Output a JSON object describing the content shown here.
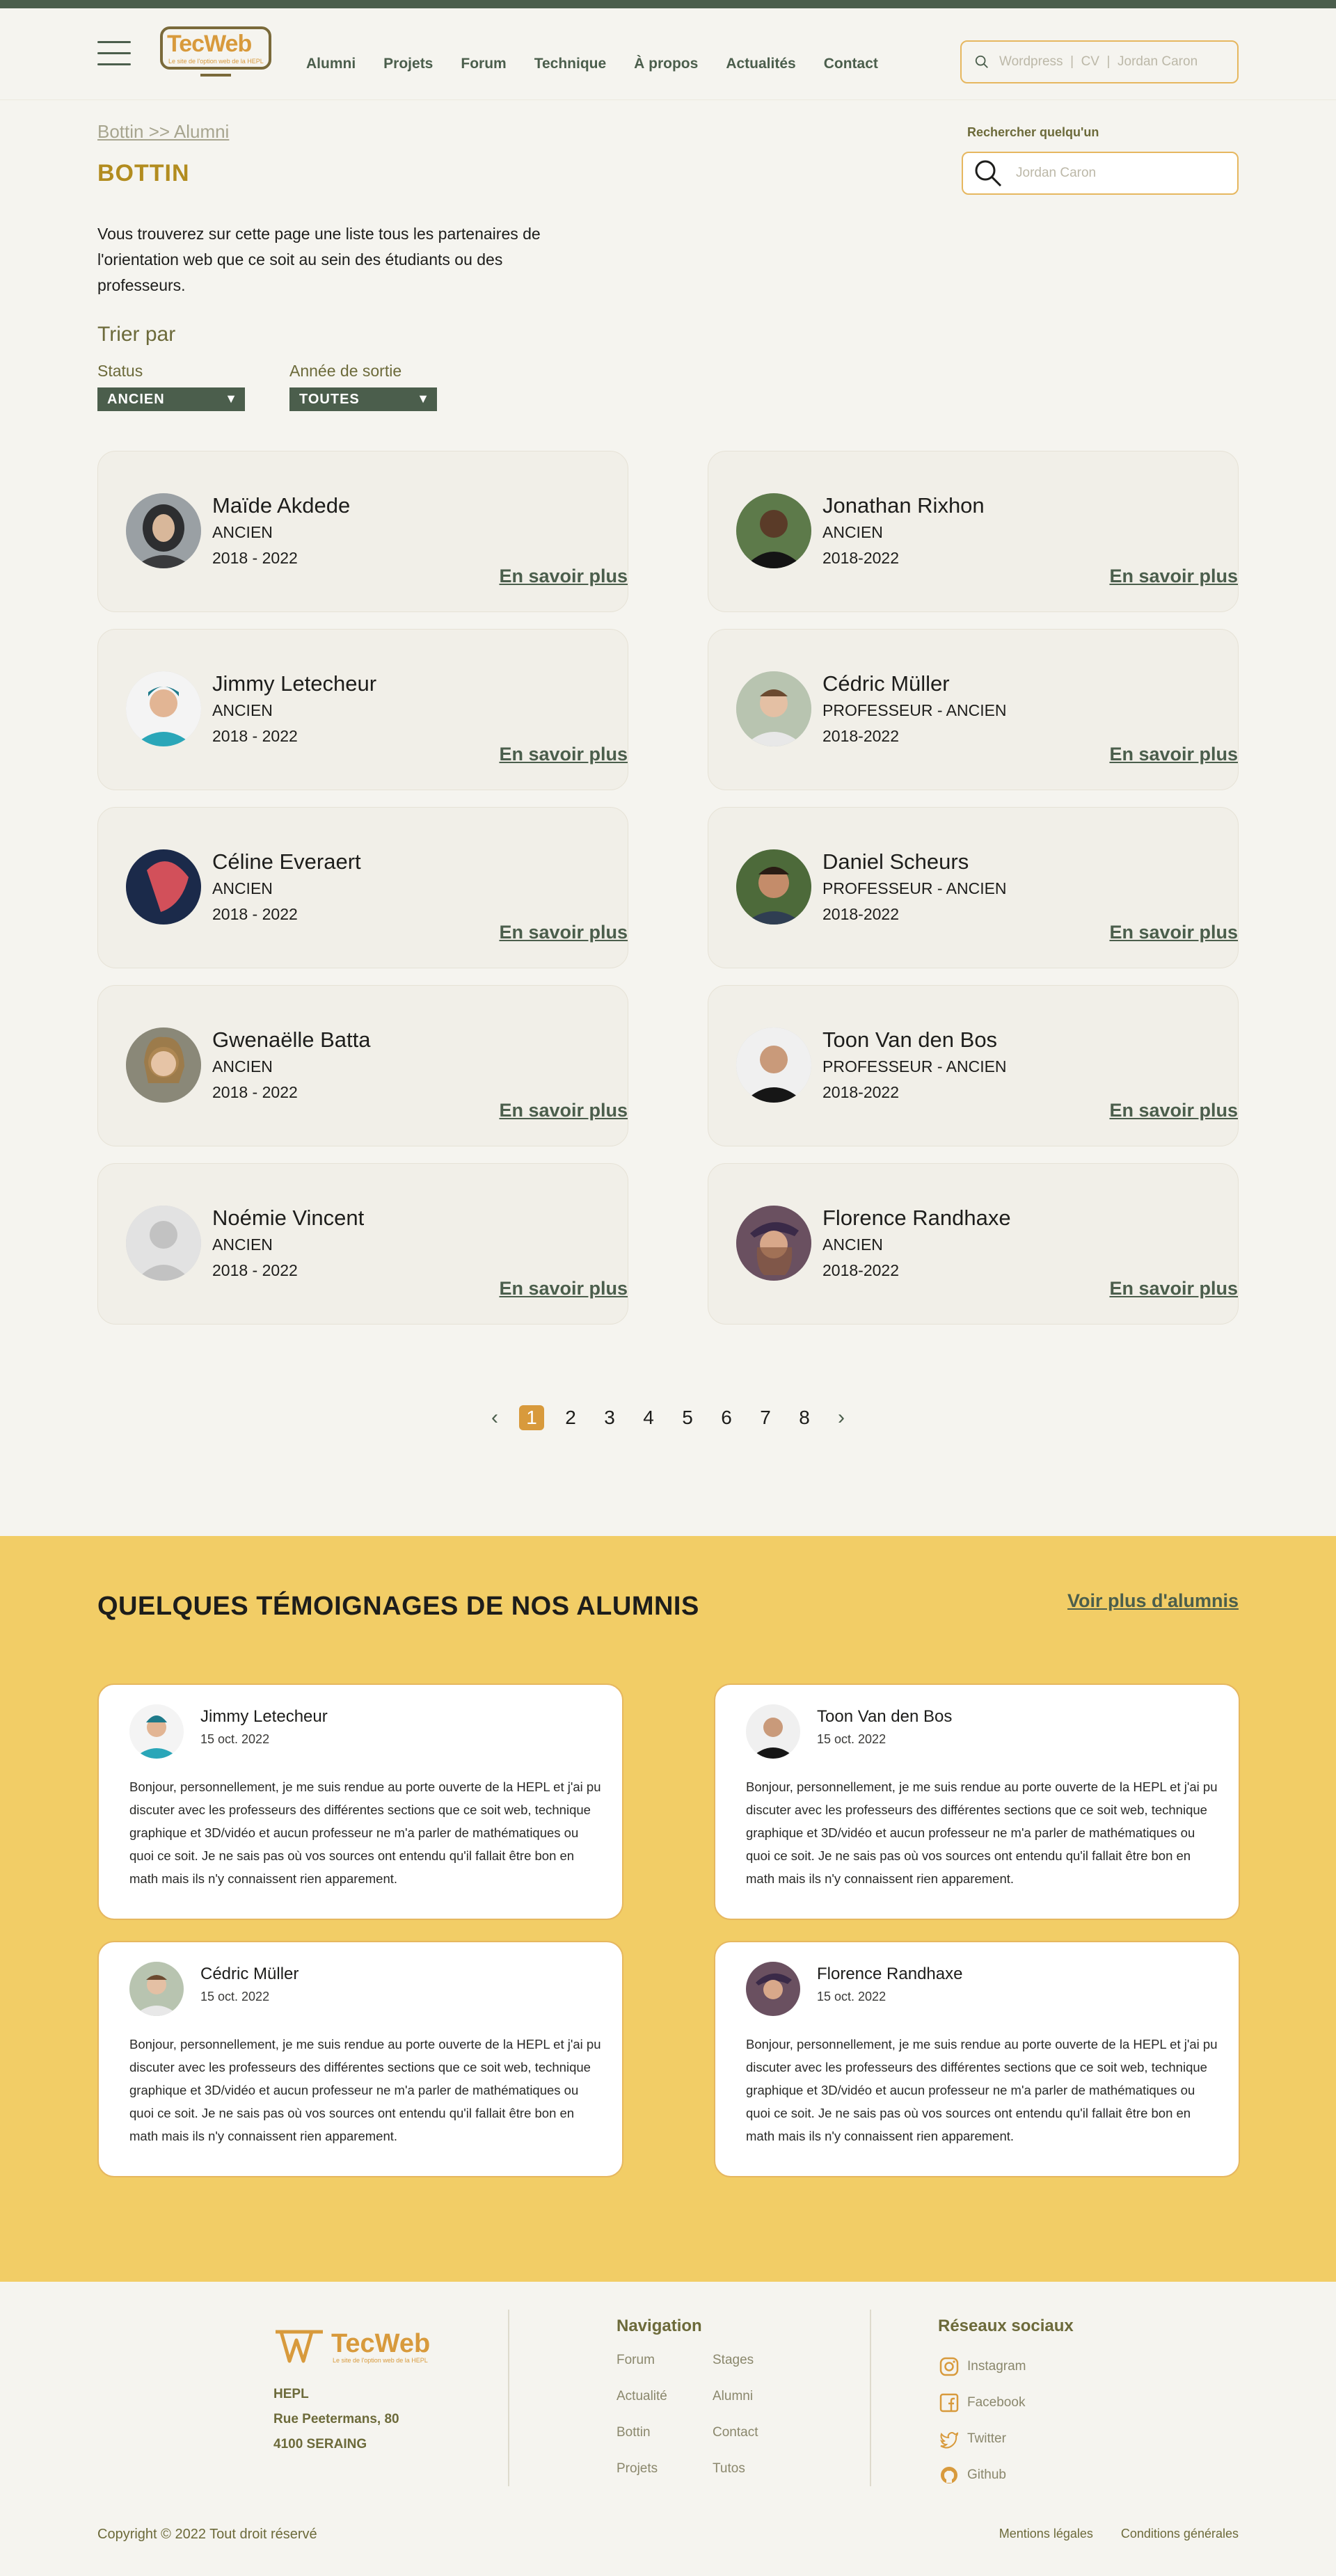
{
  "header": {
    "logo_text": "TecWeb",
    "logo_tagline": "Le site de l'option web de la HEPL",
    "nav": [
      "Alumni",
      "Projets",
      "Forum",
      "Technique",
      "À propos",
      "Actualités",
      "Contact"
    ],
    "search_placeholder": "Wordpress  |  CV  |  Jordan Caron"
  },
  "main": {
    "breadcrumb": "Bottin >> Alumni",
    "title": "BOTTIN",
    "intro": "Vous trouverez sur cette page une liste tous les partenaires de l'orientation web que ce soit au sein des étudiants ou des professeurs.",
    "sort_title": "Trier par",
    "filters": {
      "status_label": "Status",
      "status_value": "ANCIEN",
      "year_label": "Année de sortie",
      "year_value": "TOUTES"
    },
    "people_search_label": "Rechercher quelqu'un",
    "people_search_placeholder": "Jordan Caron",
    "more_label": "En savoir plus",
    "people": [
      {
        "name": "Maïde Akdede",
        "role": "ANCIEN",
        "years": "2018 - 2022"
      },
      {
        "name": "Jonathan Rixhon",
        "role": "ANCIEN",
        "years": "2018-2022"
      },
      {
        "name": "Jimmy Letecheur",
        "role": "ANCIEN",
        "years": "2018 - 2022"
      },
      {
        "name": "Cédric Müller",
        "role": "PROFESSEUR - ANCIEN",
        "years": "2018-2022"
      },
      {
        "name": "Céline Everaert",
        "role": "ANCIEN",
        "years": "2018 - 2022"
      },
      {
        "name": "Daniel Scheurs",
        "role": "PROFESSEUR - ANCIEN",
        "years": "2018-2022"
      },
      {
        "name": "Gwenaëlle Batta",
        "role": "ANCIEN",
        "years": "2018 - 2022"
      },
      {
        "name": "Toon Van den Bos",
        "role": "PROFESSEUR - ANCIEN",
        "years": "2018-2022"
      },
      {
        "name": "Noémie Vincent",
        "role": "ANCIEN",
        "years": "2018 - 2022"
      },
      {
        "name": "Florence Randhaxe",
        "role": "ANCIEN",
        "years": "2018-2022"
      }
    ],
    "pagination": {
      "pages": [
        "1",
        "2",
        "3",
        "4",
        "5",
        "6",
        "7",
        "8"
      ],
      "current": "1",
      "prev": "‹",
      "next": "›"
    }
  },
  "testimonials": {
    "title": "QUELQUES TÉMOIGNAGES DE NOS ALUMNIS",
    "more": "Voir plus d'alumnis",
    "items": [
      {
        "name": "Jimmy Letecheur",
        "date": "15 oct. 2022",
        "text": "Bonjour, personnellement, je me suis rendue au porte ouverte de la HEPL et j'ai pu discuter avec les professeurs des différentes sections que ce soit web, technique graphique et 3D/vidéo et aucun professeur ne m'a parler de mathématiques ou quoi ce soit. Je ne sais pas où vos sources ont entendu qu'il fallait être bon en math mais ils n'y connaissent rien apparement."
      },
      {
        "name": "Toon Van den Bos",
        "date": "15 oct. 2022",
        "text": "Bonjour, personnellement, je me suis rendue au porte ouverte de la HEPL et j'ai pu discuter avec les professeurs des différentes sections que ce soit web, technique graphique et 3D/vidéo et aucun professeur ne m'a parler de mathématiques ou quoi ce soit. Je ne sais pas où vos sources ont entendu qu'il fallait être bon en math mais ils n'y connaissent rien apparement."
      },
      {
        "name": "Cédric Müller",
        "date": "15 oct. 2022",
        "text": "Bonjour, personnellement, je me suis rendue au porte ouverte de la HEPL et j'ai pu discuter avec les professeurs des différentes sections que ce soit web, technique graphique et 3D/vidéo et aucun professeur ne m'a parler de mathématiques ou quoi ce soit. Je ne sais pas où vos sources ont entendu qu'il fallait être bon en math mais ils n'y connaissent rien apparement."
      },
      {
        "name": "Florence Randhaxe",
        "date": "15 oct. 2022",
        "text": "Bonjour, personnellement, je me suis rendue au porte ouverte de la HEPL et j'ai pu discuter avec les professeurs des différentes sections que ce soit web, technique graphique et 3D/vidéo et aucun professeur ne m'a parler de mathématiques ou quoi ce soit. Je ne sais pas où vos sources ont entendu qu'il fallait être bon en math mais ils n'y connaissent rien apparement."
      }
    ]
  },
  "footer": {
    "logo_text": "TecWeb",
    "logo_tagline": "Le site de l'option web de la HEPL",
    "address": [
      "HEPL",
      "Rue Peetermans, 80",
      "4100 SERAING"
    ],
    "nav_title": "Navigation",
    "nav_col1": [
      "Forum",
      "Actualité",
      "Bottin",
      "Projets"
    ],
    "nav_col2": [
      "Stages",
      "Alumni",
      "Contact",
      "Tutos"
    ],
    "social_title": "Réseaux sociaux",
    "social": [
      {
        "label": "Instagram",
        "icon": "instagram-icon"
      },
      {
        "label": "Facebook",
        "icon": "facebook-icon"
      },
      {
        "label": "Twitter",
        "icon": "twitter-icon"
      },
      {
        "label": "Github",
        "icon": "github-icon"
      }
    ],
    "copyright": "Copyright © 2022 Tout droit réservé",
    "legal": [
      "Mentions légales",
      "Conditions générales"
    ]
  },
  "colors": {
    "accent_green": "#4b5e4c",
    "accent_orange": "#d89a3c",
    "gold_title": "#b28c1f",
    "testimonials_bg": "#f2cd66",
    "background": "#f5f4ef"
  }
}
